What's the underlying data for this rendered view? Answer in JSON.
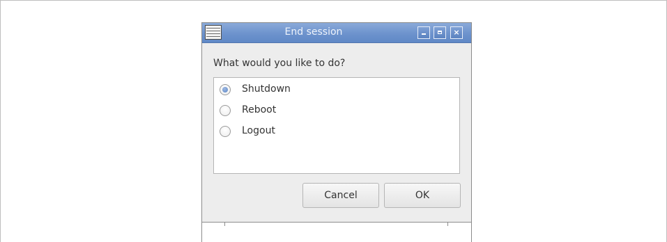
{
  "window": {
    "title": "End session",
    "controls": {
      "minimize_icon": "minimize-icon",
      "maximize_icon": "maximize-icon",
      "close_icon": "close-icon",
      "close_glyph": "×"
    },
    "app_icon": "window-app-icon"
  },
  "dialog": {
    "question": "What would you like to do?",
    "options": [
      {
        "label": "Shutdown",
        "checked": true
      },
      {
        "label": "Reboot",
        "checked": false
      },
      {
        "label": "Logout",
        "checked": false
      }
    ],
    "buttons": {
      "cancel": "Cancel",
      "ok": "OK"
    }
  },
  "colors": {
    "titlebar": "#6d93cd",
    "radio_selected": "#5a85c6",
    "dialog_bg": "#ededed"
  }
}
